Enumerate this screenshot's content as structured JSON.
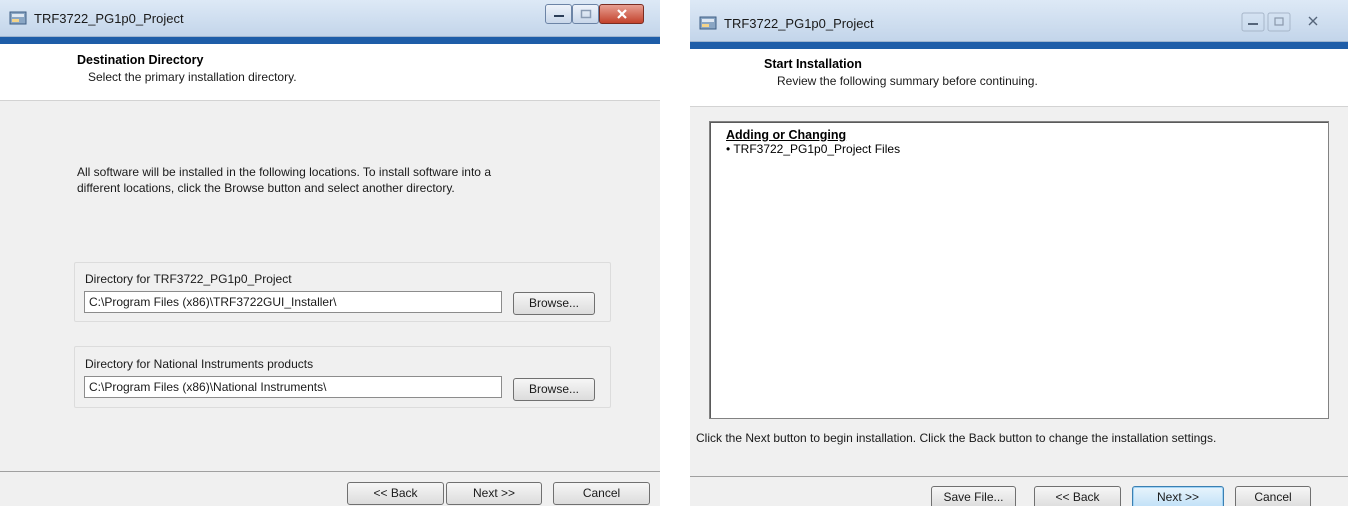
{
  "left_window": {
    "title": "TRF3722_PG1p0_Project",
    "header": {
      "title": "Destination Directory",
      "subtitle": "Select the primary installation directory."
    },
    "intro_line1": "All software will be installed in the following locations. To install software into a",
    "intro_line2": "different locations, click the Browse button and select another directory.",
    "groups": [
      {
        "label": "Directory for TRF3722_PG1p0_Project",
        "path": "C:\\Program Files (x86)\\TRF3722GUI_Installer\\",
        "browse_label": "Browse..."
      },
      {
        "label": "Directory for National Instruments products",
        "path": "C:\\Program Files (x86)\\National Instruments\\",
        "browse_label": "Browse..."
      }
    ],
    "buttons": {
      "back": "<< Back",
      "next": "Next >>",
      "cancel": "Cancel"
    }
  },
  "right_window": {
    "title": "TRF3722_PG1p0_Project",
    "header": {
      "title": "Start Installation",
      "subtitle": "Review the following summary before continuing."
    },
    "summary": {
      "heading": "Adding or Changing",
      "items": [
        "• TRF3722_PG1p0_Project Files"
      ]
    },
    "instruction": "Click the Next button to begin installation.  Click the Back button to change the installation settings.",
    "buttons": {
      "save_file": "Save File...",
      "back": "<< Back",
      "next": "Next >>",
      "cancel": "Cancel"
    }
  },
  "colors": {
    "accent_bar": "#1e5da8",
    "titlebar_top": "#dde9f6",
    "titlebar_bottom": "#c3d5ea",
    "dialog_bg": "#f0f0f0",
    "close_button": "#c3422c"
  },
  "icons": {
    "app": "installer-icon",
    "minimize": "minimize-icon",
    "maximize": "maximize-icon",
    "close": "close-icon"
  }
}
